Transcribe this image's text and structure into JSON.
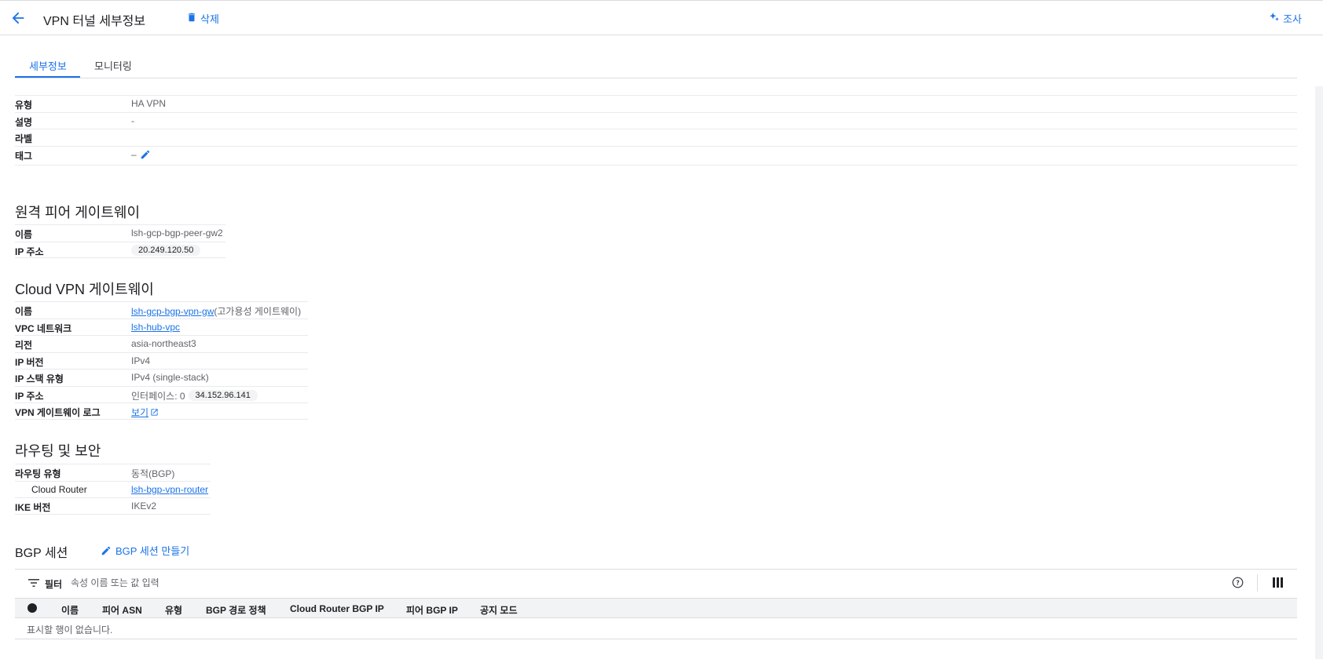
{
  "header": {
    "title": "VPN 터널 세부정보",
    "delete_label": "삭제",
    "investigate_label": "조사"
  },
  "tabs": [
    {
      "label": "세부정보",
      "active": true
    },
    {
      "label": "모니터링",
      "active": false
    }
  ],
  "general": {
    "type_label": "유형",
    "type_value": "HA VPN",
    "desc_label": "설명",
    "desc_value": "-",
    "labels_label": "라벨",
    "labels_value": "",
    "tags_label": "태그",
    "tags_value": "–"
  },
  "peer_gateway": {
    "title": "원격 피어 게이트웨이",
    "name_label": "이름",
    "name_value": "lsh-gcp-bgp-peer-gw2",
    "ip_label": "IP 주소",
    "ip_value": "20.249.120.50"
  },
  "cloud_vpn_gateway": {
    "title": "Cloud VPN 게이트웨이",
    "name_label": "이름",
    "name_value": "lsh-gcp-bgp-vpn-gw",
    "name_suffix": "(고가용성 게이트웨이)",
    "vpc_label": "VPC 네트워크",
    "vpc_value": "lsh-hub-vpc",
    "region_label": "리전",
    "region_value": "asia-northeast3",
    "ip_version_label": "IP 버전",
    "ip_version_value": "IPv4",
    "ip_stack_label": "IP 스택 유형",
    "ip_stack_value": "IPv4 (single-stack)",
    "ip_addr_label": "IP 주소",
    "ip_addr_prefix": "인터페이스: 0",
    "ip_addr_value": "34.152.96.141",
    "log_label": "VPN 게이트웨이 로그",
    "log_value": "보기"
  },
  "routing": {
    "title": "라우팅 및 보안",
    "type_label": "라우팅 유형",
    "type_value": "동적(BGP)",
    "router_label": "Cloud Router",
    "router_value": "lsh-bgp-vpn-router",
    "ike_label": "IKE 버전",
    "ike_value": "IKEv2"
  },
  "bgp": {
    "title": "BGP 세션",
    "create_label": "BGP 세션 만들기",
    "filter_label": "필터",
    "filter_placeholder": "속성 이름 또는 값 입력",
    "columns": [
      "이름",
      "피어 ASN",
      "유형",
      "BGP 경로 정책",
      "Cloud Router BGP IP",
      "피어 BGP IP",
      "공지 모드"
    ],
    "empty_text": "표시할 행이 없습니다."
  },
  "colors": {
    "accent": "#1a73e8",
    "border": "#dadce0",
    "header_bg": "#f1f3f4"
  }
}
